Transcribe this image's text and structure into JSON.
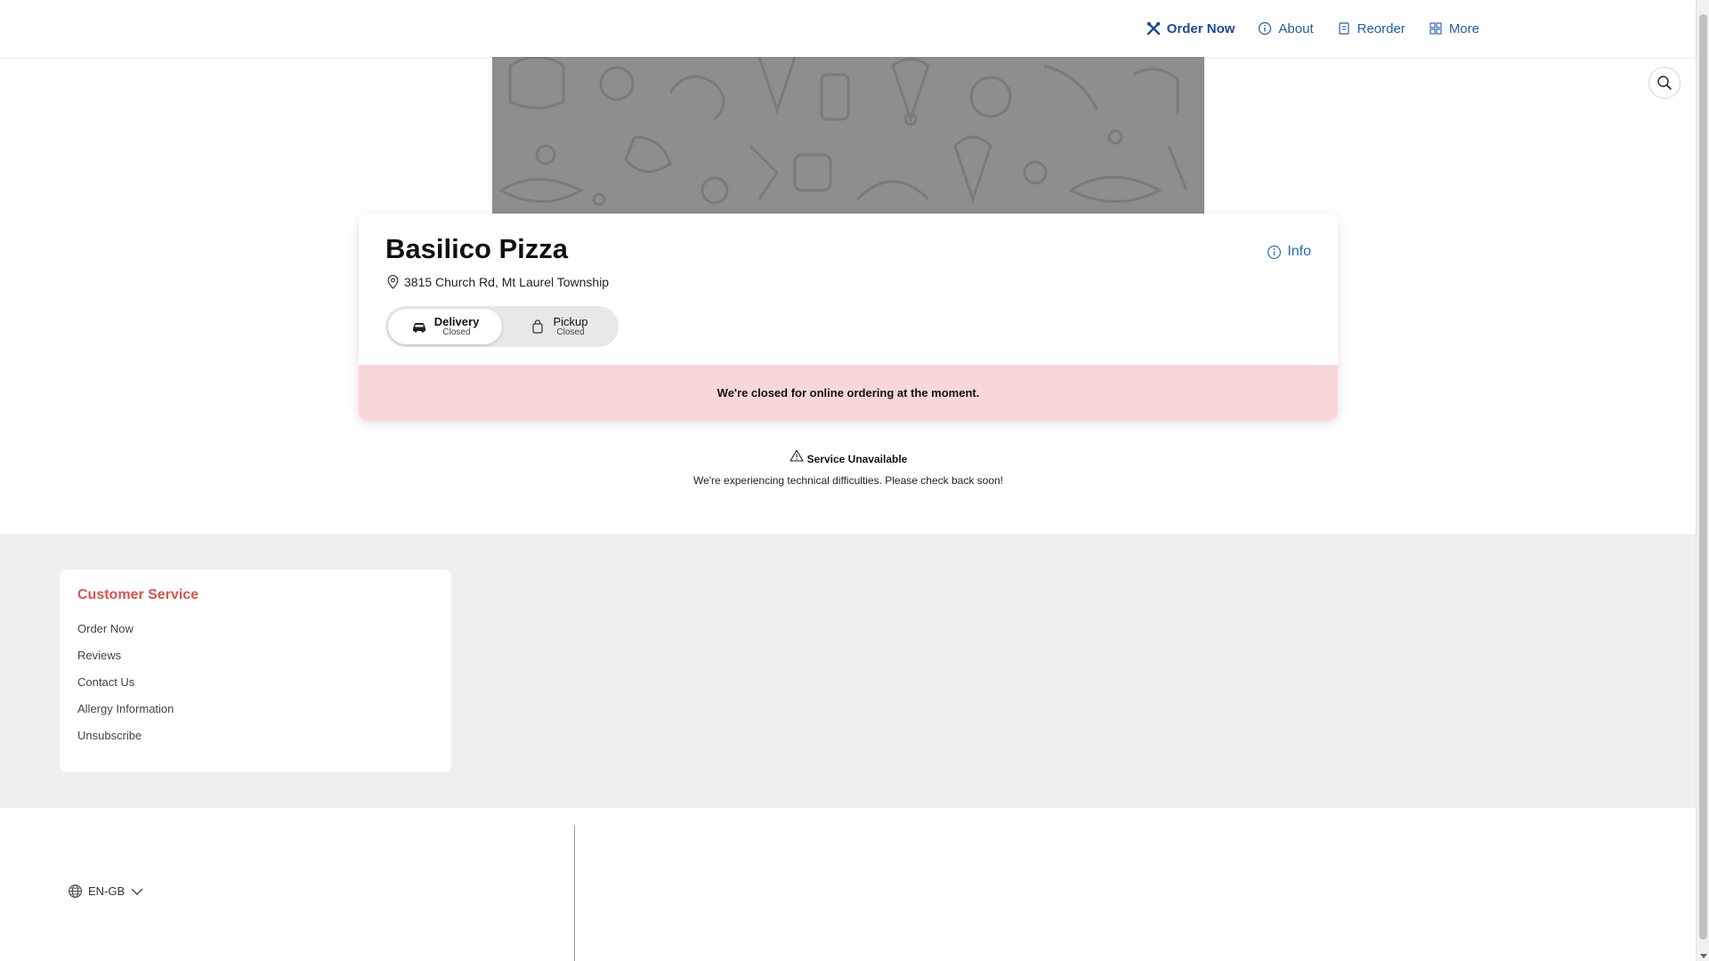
{
  "nav": {
    "items": [
      {
        "label": "Order Now",
        "icon": "utensils-icon",
        "active": true
      },
      {
        "label": "About",
        "icon": "info-circle-icon",
        "active": false
      },
      {
        "label": "Reorder",
        "icon": "receipt-icon",
        "active": false
      },
      {
        "label": "More",
        "icon": "grid-icon",
        "active": false
      }
    ]
  },
  "store": {
    "name": "Basilico Pizza",
    "address": "3815 Church Rd, Mt Laurel Township",
    "info_label": "Info",
    "modes": [
      {
        "label": "Delivery",
        "status": "Closed",
        "selected": true,
        "icon": "car-icon"
      },
      {
        "label": "Pickup",
        "status": "Closed",
        "selected": false,
        "icon": "bag-icon"
      }
    ],
    "closed_message": "We're closed for online ordering at the moment."
  },
  "service": {
    "title": "Service Unavailable",
    "message": "We're experiencing technical difficulties. Please check back soon!"
  },
  "footer": {
    "customer_service": {
      "title": "Customer Service",
      "links": [
        "Order Now",
        "Reviews",
        "Contact Us",
        "Allergy Information",
        "Unsubscribe"
      ]
    },
    "language": "EN-GB"
  },
  "colors": {
    "nav_link": "#1e5fa8",
    "accent_red": "#d9534f",
    "closed_banner": "#f8d7da",
    "hero_bg": "#8e8e8e",
    "footer_bg": "#efefef"
  }
}
